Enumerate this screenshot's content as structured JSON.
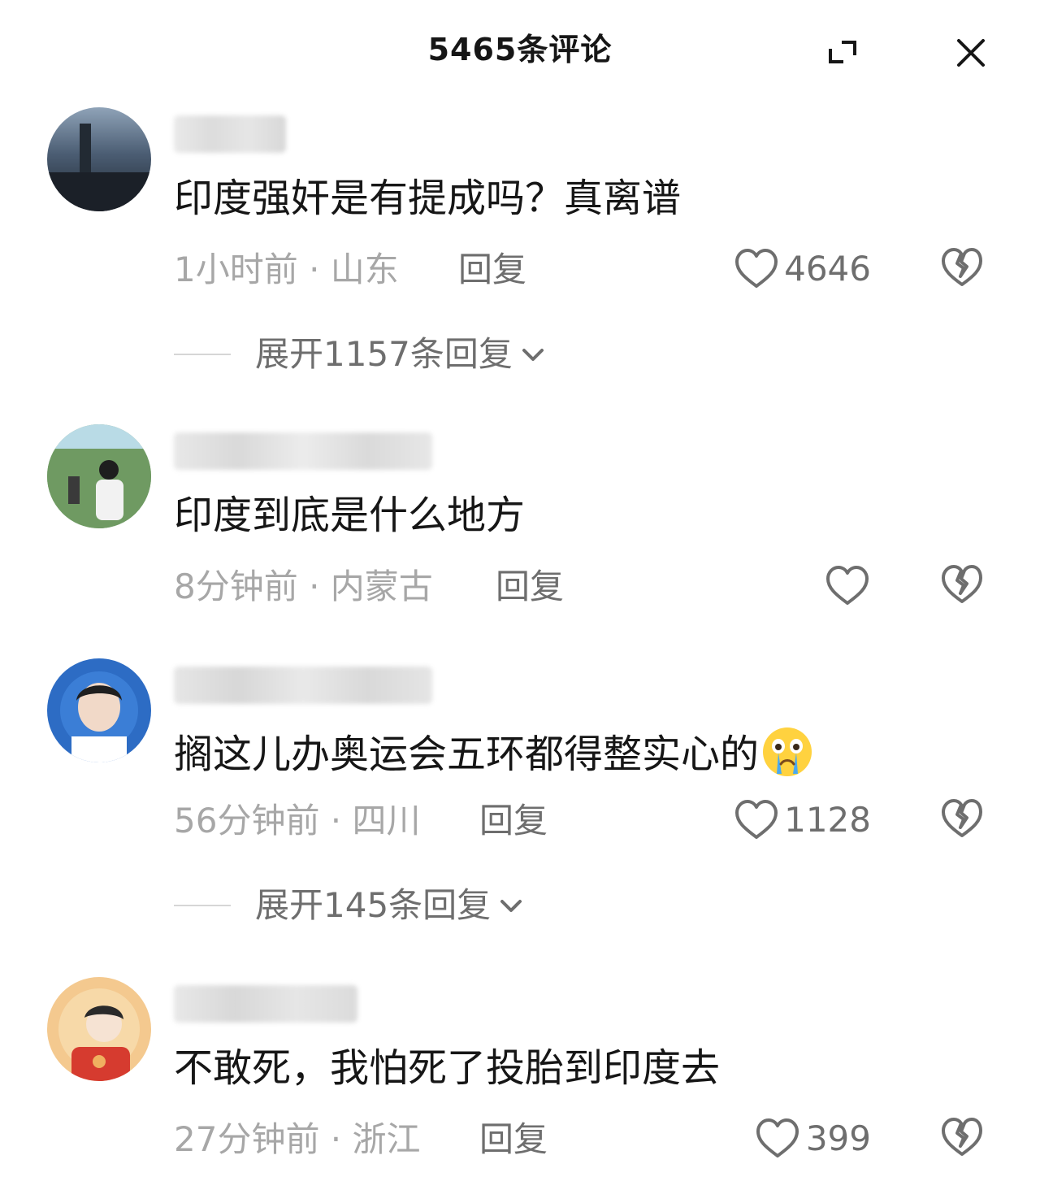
{
  "header": {
    "title": "5465条评论",
    "expand_icon": "expand-icon",
    "close_icon": "close-icon"
  },
  "comments": [
    {
      "text": "印度强奸是有提成吗？真离谱",
      "time_location": "1小时前 · 山东",
      "reply_label": "回复",
      "like_count": "4646",
      "expand_label": "展开1157条回复"
    },
    {
      "text": "印度到底是什么地方",
      "time_location": "8分钟前 · 内蒙古",
      "reply_label": "回复",
      "like_count": ""
    },
    {
      "text": "搁这儿办奥运会五环都得整实心的",
      "emoji": "crying-face-emoji",
      "time_location": "56分钟前 · 四川",
      "reply_label": "回复",
      "like_count": "1128",
      "expand_label": "展开145条回复"
    },
    {
      "text": "不敢死，我怕死了投胎到印度去",
      "time_location": "27分钟前 · 浙江",
      "reply_label": "回复",
      "like_count": "399"
    }
  ],
  "icons": {
    "like": "heart-outline-icon",
    "dislike": "broken-heart-icon",
    "expand_chevron": "chevron-down-icon"
  },
  "colors": {
    "text_primary": "#161616",
    "text_meta": "#a7a7a7",
    "text_secondary": "#6e6e6e",
    "background": "#ffffff"
  }
}
